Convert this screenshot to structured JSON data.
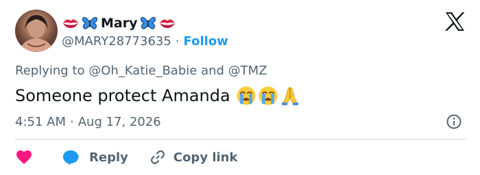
{
  "author": {
    "display_name": "Mary",
    "handle": "@MARY28773635",
    "follow_label": "Follow",
    "separator": "·"
  },
  "reply_context": {
    "prefix": "Replying to",
    "mention_1": "@Oh_Katie_Babie",
    "conjunction": "and",
    "mention_2": "@TMZ"
  },
  "tweet": {
    "text": "Someone protect Amanda",
    "emojis": [
      "loudly-crying-face",
      "loudly-crying-face",
      "folded-hands"
    ]
  },
  "meta": {
    "time": "4:51 AM",
    "separator": "·",
    "date": "Aug 17, 2026"
  },
  "actions": {
    "reply_label": "Reply",
    "copy_link_label": "Copy link"
  },
  "colors": {
    "accent": "#1d9bf0",
    "like": "#f91880",
    "secondary_text": "#536471",
    "primary_text": "#0f1419",
    "divider": "#cfd9de"
  },
  "icons": [
    "kiss-mark-icon",
    "butterfly-icon",
    "x-logo-icon",
    "info-icon",
    "heart-icon",
    "reply-bubble-icon",
    "link-icon"
  ]
}
